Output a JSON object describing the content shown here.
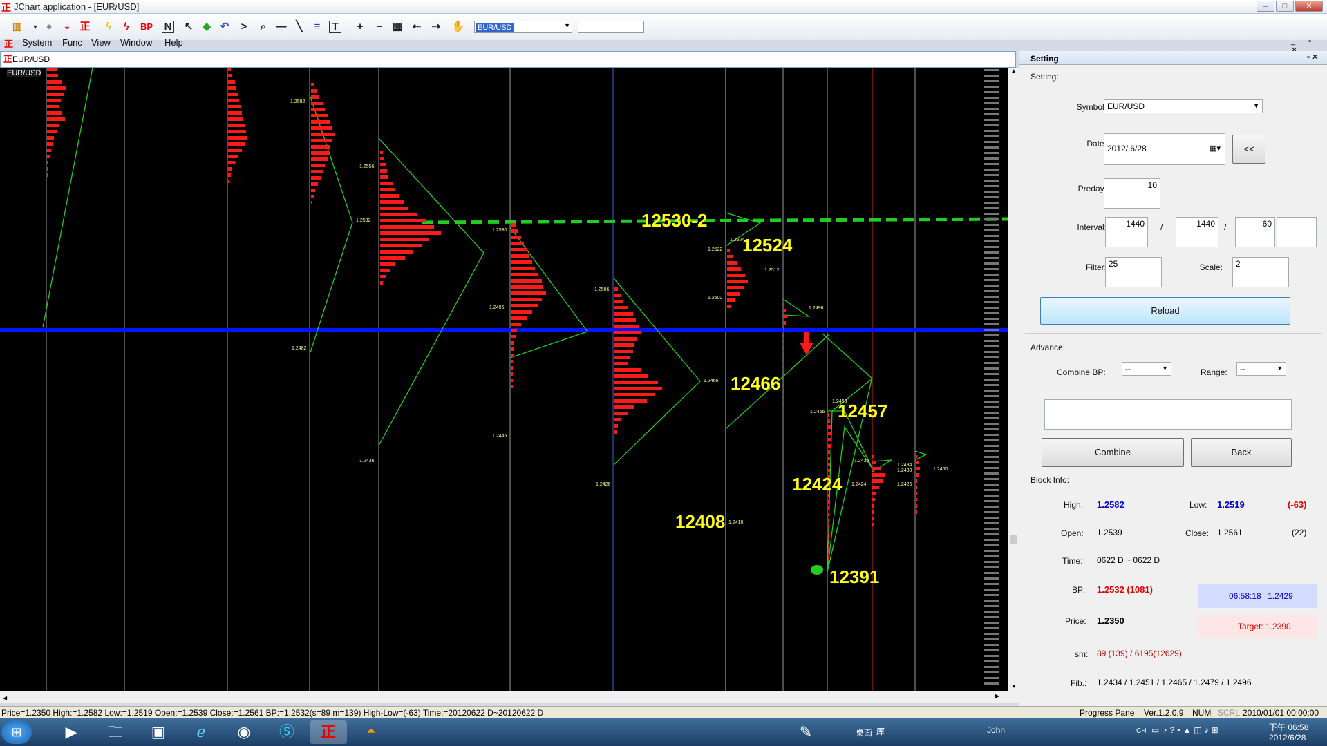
{
  "window": {
    "title": "JChart application - [EUR/USD]",
    "logo": "正"
  },
  "toolbar": {
    "bp_label": "BP",
    "n_label": "N",
    "t_label": "T",
    "symbol_value": "EUR/USD"
  },
  "menu": [
    "System",
    "Func",
    "View",
    "Window",
    "Help"
  ],
  "tab": {
    "label": "EUR/USD"
  },
  "chart": {
    "symbol_label": "EUR/USD",
    "price_labels": [
      "1.2582",
      "1.2556",
      "1.2532",
      "1.2530",
      "1.2506",
      "1.2496",
      "1.2482",
      "1.2446",
      "1.2436",
      "1.2426",
      "1.2522",
      "1.2502",
      "1.2524",
      "1.2512",
      "1.2496",
      "1.2466",
      "1.2456",
      "1.2458",
      "1.2436",
      "1.2424",
      "1.2426",
      "1.2434",
      "1.2430",
      "1.2450",
      "1.2410",
      "1.2420"
    ],
    "annotations": [
      "12530-2",
      "12524",
      "12466",
      "12457",
      "12424",
      "12408",
      "12391"
    ],
    "colors": {
      "blue_line": "#0015ff",
      "green_line": "#22cc22",
      "red_profile": "#ff1a1a",
      "yellow": "#ffff1a"
    }
  },
  "setting": {
    "title": "Setting",
    "section": "Setting:",
    "symbol_label": "Symbol:",
    "symbol_value": "EUR/USD",
    "date_label": "Date:",
    "date_value": "2012/ 6/28",
    "prev_btn": "<<",
    "preday_label": "Preday:",
    "preday_value": "10",
    "interval_label": "Interval:",
    "interval1": "1440",
    "interval2": "1440",
    "interval3": "60",
    "sep": "/",
    "filter_label": "Filter:",
    "filter_value": "25",
    "scale_label": "Scale:",
    "scale_value": "2",
    "reload_btn": "Reload",
    "advance_label": "Advance:",
    "combine_bp_label": "Combine BP:",
    "combine_bp_value": "--",
    "range_label": "Range:",
    "range_value": "--",
    "combine_btn": "Combine",
    "back_btn": "Back",
    "block_info_label": "Block Info:",
    "high_label": "High:",
    "high_value": "1.2582",
    "low_label": "Low:",
    "low_value": "1.2519",
    "diff_value": "(-63)",
    "open_label": "Open:",
    "open_value": "1.2539",
    "close_label": "Close:",
    "close_value": "1.2561",
    "count_value": "(22)",
    "time_label": "Time:",
    "time_value": "0622 D ~ 0622 D",
    "bp_label": "BP:",
    "bp_value": "1.2532 (1081)",
    "live_time": "06:58:18",
    "live_price": "1.2429",
    "price_label": "Price:",
    "price_value": "1.2350",
    "target_text": "Target: 1.2390",
    "sm_label": "sm:",
    "sm_value": "89 (139) / 6195(12629)",
    "fib_label": "Fib.:",
    "fib_value": "1.2434 / 1.2451 / 1.2465 / 1.2479 / 1.2496"
  },
  "status": {
    "text": "Price=1.2350   High:=1.2582   Low:=1.2519   Open:=1.2539   Close:=1.2561   BP:=1.2532(s=89 m=139)   High-Low=(-63)   Time:=20120622 D~20120622 D",
    "progress": "Progress Pane",
    "version": "Ver.1.2.0.9",
    "num": "NUM",
    "scrl": "SCRL",
    "datetime": "2010/01/01 00:00:00"
  },
  "taskbar": {
    "desktop": "桌面",
    "lib": "库",
    "user": "John",
    "lang": "CH",
    "time": "下午 06:58",
    "date": "2012/6/28"
  }
}
